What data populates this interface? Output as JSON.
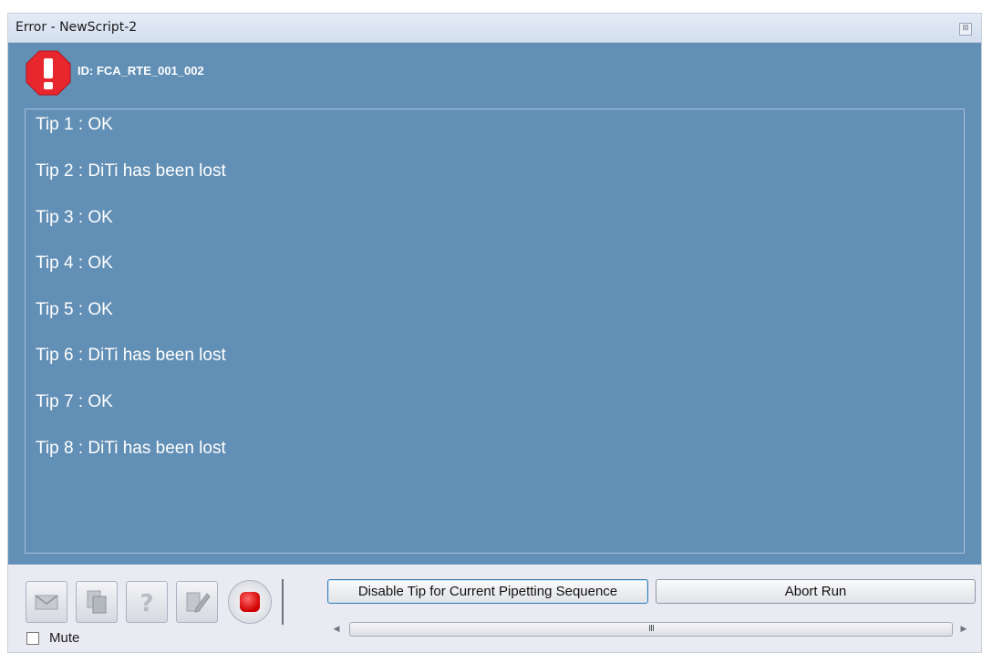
{
  "window": {
    "title": "Error - NewScript-2",
    "close_glyph": "⊠"
  },
  "error": {
    "id": "ID: FCA_RTE_001_002",
    "icon": "error-octagon-icon",
    "icon_color": "#e8262d"
  },
  "messages": [
    "Tip 1 : OK",
    "Tip 2 : DiTi has been lost",
    "Tip 3 : OK",
    "Tip 4 : OK",
    "Tip 5 : OK",
    "Tip 6 : DiTi has been lost",
    "Tip 7 : OK",
    "Tip 8 : DiTi has been lost"
  ],
  "toolbar": {
    "icons": [
      "mail-icon",
      "copy-icon",
      "help-icon",
      "edit-icon",
      "stop-icon"
    ],
    "mute_label": "Mute",
    "mute_checked": false
  },
  "actions": {
    "disable_tip_label": "Disable Tip for Current Pipetting Sequence",
    "abort_run_label": "Abort Run"
  },
  "scrollbar": {
    "left_arrow": "◀",
    "right_arrow": "▶",
    "grip": "III"
  },
  "colors": {
    "panel": "#628fb5",
    "text": "#ffffff"
  }
}
